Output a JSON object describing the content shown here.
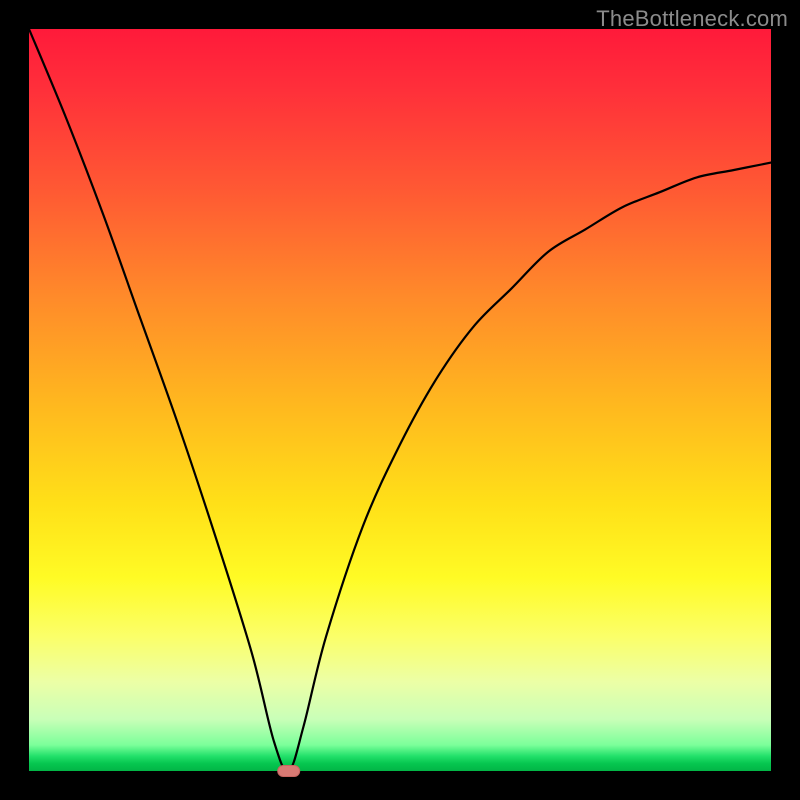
{
  "watermark": "TheBottleneck.com",
  "colors": {
    "frame": "#000000",
    "curve": "#000000",
    "marker": "#d87a74",
    "gradient_top": "#ff1a3a",
    "gradient_mid": "#ffe018",
    "gradient_bottom": "#02b546"
  },
  "chart_data": {
    "type": "line",
    "title": "",
    "xlabel": "",
    "ylabel": "",
    "xlim": [
      0,
      100
    ],
    "ylim": [
      0,
      100
    ],
    "grid": false,
    "legend": false,
    "annotations": [],
    "series": [
      {
        "name": "bottleneck-curve",
        "x": [
          0,
          5,
          10,
          15,
          20,
          25,
          30,
          33,
          35,
          37,
          40,
          45,
          50,
          55,
          60,
          65,
          70,
          75,
          80,
          85,
          90,
          95,
          100
        ],
        "values": [
          100,
          88,
          75,
          61,
          47,
          32,
          16,
          4,
          0,
          6,
          18,
          33,
          44,
          53,
          60,
          65,
          70,
          73,
          76,
          78,
          80,
          81,
          82
        ]
      }
    ],
    "minimum": {
      "x": 35,
      "y": 0
    }
  }
}
